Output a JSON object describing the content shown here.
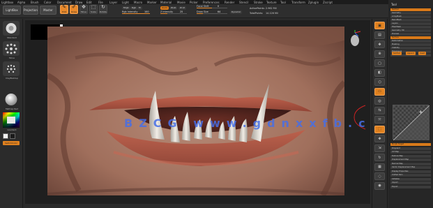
{
  "menubar": {
    "items": [
      "Lightbox",
      "Alpha",
      "Brush",
      "Color",
      "Document",
      "Draw",
      "Edit",
      "File",
      "Layer",
      "Light",
      "Macro",
      "Marker",
      "Material",
      "Movie",
      "Picker",
      "Preferences",
      "Render",
      "Stencil",
      "Stroke",
      "Texture",
      "Tool",
      "Transform",
      "Zplugin",
      "Zscript"
    ]
  },
  "toolbar": {
    "mode_buttons": [
      "LightBox",
      "Projection",
      "Master"
    ],
    "tools": [
      {
        "label": "Edit",
        "icon": "edit-icon",
        "active": true
      },
      {
        "label": "Draw",
        "icon": "draw-icon",
        "active": true
      },
      {
        "label": "Move",
        "icon": "move-icon",
        "active": false
      },
      {
        "label": "Scale",
        "icon": "scale-icon",
        "active": false
      },
      {
        "label": "Rotate",
        "icon": "rotate-icon",
        "active": false
      }
    ],
    "brush_modes": [
      {
        "label": "Mrgb",
        "active": false
      },
      {
        "label": "Rgb",
        "active": false
      },
      {
        "label": "M",
        "active": false
      }
    ],
    "intensity": {
      "label": "Rgb Intensity",
      "value": "100",
      "fraction": 1.0
    },
    "sculpt_modes": [
      {
        "label": "Zadd",
        "active": true
      },
      {
        "label": "Zsub",
        "active": false
      },
      {
        "label": "Zcut",
        "active": false
      }
    ],
    "z_intensity": {
      "label": "Z Intensity",
      "value": "25",
      "fraction": 0.25
    },
    "focal_shift": {
      "label": "Focal Shift",
      "value": "0",
      "fraction": 0.5
    },
    "draw_size": {
      "label": "Draw Size",
      "value": "64",
      "fraction": 0.2
    },
    "dynamic": {
      "label": "Dynamic",
      "active": false
    },
    "active_points": {
      "label": "ActivePoints:",
      "value": "2.962 Mil"
    },
    "total_points": {
      "label": "TotalPoints:",
      "value": "14.126 Mil"
    }
  },
  "left_shelf": {
    "brush_labels": [
      "Standard",
      "Move",
      "ClayBuildup",
      "DamStandard"
    ],
    "material_label": "MatCap Red",
    "color_label": "Gradient",
    "switch_color_label": "SwitchColor"
  },
  "right_shelf": {
    "buttons": [
      {
        "icon": "bpr-icon",
        "label": "BPR"
      },
      {
        "icon": "spix-icon",
        "label": "SPix"
      },
      {
        "icon": "scroll-icon",
        "label": "Scroll"
      },
      {
        "icon": "zoom-icon",
        "label": "Zoom"
      },
      {
        "icon": "actual-icon",
        "label": "Actual"
      },
      {
        "icon": "aahalf-icon",
        "label": "AAHalf"
      },
      {
        "icon": "persp-icon",
        "label": "Persp"
      },
      {
        "icon": "floor-icon",
        "label": "Floor"
      },
      {
        "icon": "local-icon",
        "label": "Local"
      },
      {
        "icon": "lsym-icon",
        "label": "LSym"
      },
      {
        "icon": "xyz-icon",
        "label": "Gxyz"
      },
      {
        "icon": "frame-icon",
        "label": "Frame"
      },
      {
        "icon": "move-icon",
        "label": "Move"
      },
      {
        "icon": "scale-icon",
        "label": "Scale"
      },
      {
        "icon": "rotate-icon",
        "label": "Rotate"
      },
      {
        "icon": "polyf-icon",
        "label": "PolyF"
      },
      {
        "icon": "transp-icon",
        "label": "Transp"
      },
      {
        "icon": "solo-icon",
        "label": "Solo"
      }
    ]
  },
  "palette": {
    "title": "Tool",
    "rows": [
      "SubTool",
      "Geometry",
      "ArrayMesh",
      "NanoMesh",
      "Layers",
      "FiberMesh",
      "Geometry HD",
      "Preview",
      "Surface",
      "Deformation",
      "Masking",
      "Visibility",
      "Polygroups",
      "Contact",
      "Morph Target",
      "Polypaint",
      "UV Map",
      "Texture Map",
      "Displacement Map",
      "Normal Map",
      "Vector Displacement Map",
      "Display Properties",
      "Unified Skin",
      "Initialize",
      "Import",
      "Export"
    ],
    "chips": [
      "SubTool",
      "Append",
      "Insert"
    ]
  },
  "canvas": {
    "watermark": "BZCG www.gdnxxfb.cn"
  },
  "colors": {
    "accent": "#e0811f",
    "panel": "#2b2b2b",
    "skin": "#b07a66",
    "teeth": "#d8d4cc"
  }
}
